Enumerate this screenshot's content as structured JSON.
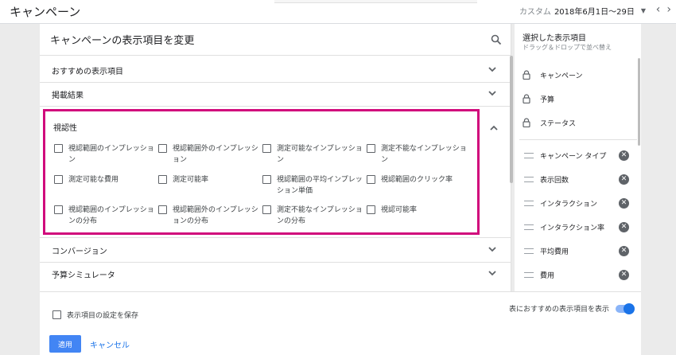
{
  "topbar": {
    "title": "キャンペーン",
    "date_label": "カスタム",
    "date_range": "2018年6月1日〜29日"
  },
  "panel": {
    "title": "キャンペーンの表示項目を変更",
    "sections_top": [
      {
        "label": "おすすめの表示項目"
      },
      {
        "label": "掲載結果"
      }
    ],
    "highlight": {
      "title": "視認性",
      "items": [
        "視認範囲のインプレッション",
        "視認範囲外のインプレッション",
        "測定可能なインプレッション",
        "測定不能なインプレッション",
        "測定可能な費用",
        "測定可能率",
        "視認範囲の平均インプレッション単価",
        "視認範囲のクリック率",
        "視認範囲のインプレッションの分布",
        "視認範囲外のインプレッションの分布",
        "測定不能なインプレッションの分布",
        "視認可能率"
      ]
    },
    "sections_bottom": [
      {
        "label": "コンバージョン"
      },
      {
        "label": "予算シミュレータ"
      }
    ]
  },
  "bottom": {
    "save_label": "表示項目の設定を保存",
    "toggle_label": "表におすすめの表示項目を表示",
    "apply_label": "適用",
    "cancel_label": "キャンセル"
  },
  "selected": {
    "title": "選択した表示項目",
    "subtitle": "ドラッグ＆ドロップで並べ替え",
    "locked": [
      "キャンペーン",
      "予算",
      "ステータス"
    ],
    "movable": [
      "キャンペーン タイプ",
      "表示回数",
      "インタラクション",
      "インタラクション率",
      "平均費用",
      "費用"
    ]
  },
  "colors": {
    "highlight_border": "#d10a7c",
    "accent": "#1a73e8"
  },
  "icons": {
    "search": "search-icon",
    "chevron_down": "chevron-down-icon",
    "chevron_up": "chevron-up-icon",
    "lock": "lock-icon",
    "drag": "drag-handle-icon",
    "remove": "remove-icon"
  }
}
